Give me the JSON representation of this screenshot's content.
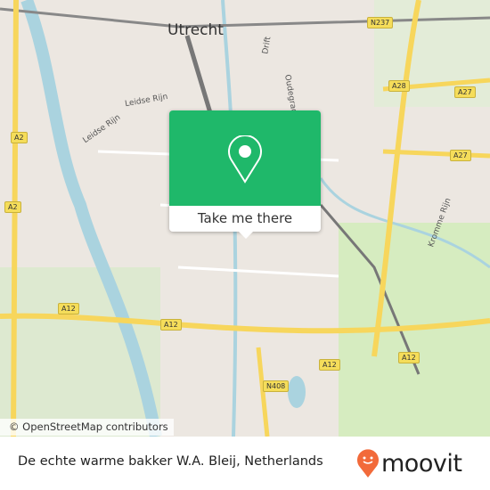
{
  "map": {
    "city_label": "Utrecht",
    "street_labels": [
      "Leidse Rijn",
      "Leidse Rijn",
      "Drift",
      "Oudegracht",
      "Kromme Rijn"
    ],
    "road_shields": [
      "N237",
      "A28",
      "A27",
      "A27",
      "A2",
      "A2",
      "A12",
      "A12",
      "A12",
      "A12",
      "N408"
    ],
    "attribution": "© OpenStreetMap contributors",
    "colors": {
      "land": "#ece7e1",
      "water": "#aad3df",
      "green": "#cdebb0",
      "motorway": "#f7d65c"
    }
  },
  "popup": {
    "icon": "map-pin-icon",
    "button_label": "Take me there",
    "color": "#1fb86a"
  },
  "footer": {
    "place_name": "De echte warme bakker W.A. Bleij, Netherlands",
    "logo_text": "moovit",
    "logo_color": "#f26a3a"
  }
}
